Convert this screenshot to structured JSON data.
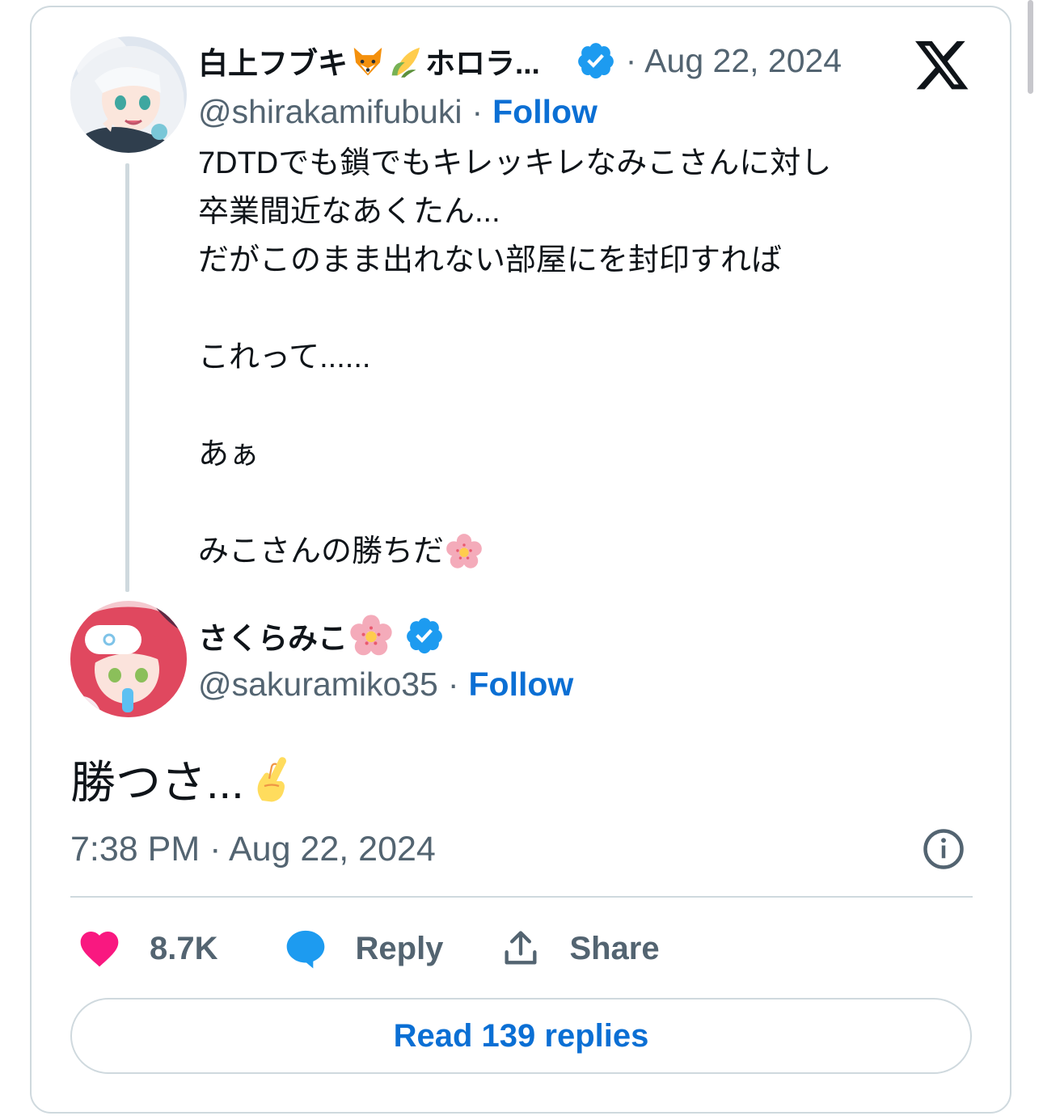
{
  "quoted_tweet": {
    "display_name": "白上フブキ",
    "name_suffix": "ホロラ...",
    "name_emojis": [
      "fox-emoji",
      "corn-emoji"
    ],
    "separator": "·",
    "date": "Aug 22, 2024",
    "handle": "@shirakamifubuki",
    "follow_label": "Follow",
    "text_lines": [
      "7DTDでも鎖でもキレッキレなみこさんに対し",
      "卒業間近なあくたん...",
      "だがこのまま出れない部屋にを封印すれば",
      "",
      "これって......",
      "",
      "あぁ",
      "",
      "みこさんの勝ちだ"
    ],
    "last_line_emoji": "cherry-blossom-emoji"
  },
  "main_tweet": {
    "display_name": "さくらみこ",
    "name_emoji": "cherry-blossom-emoji",
    "handle": "@sakuramiko35",
    "separator": "·",
    "follow_label": "Follow",
    "text": "勝つさ...",
    "text_emoji": "crossed-fingers-emoji",
    "timestamp": "7:38 PM · Aug 22, 2024"
  },
  "actions": {
    "like_count": "8.7K",
    "reply_label": "Reply",
    "share_label": "Share"
  },
  "read_replies_label": "Read 139 replies",
  "colors": {
    "link": "#0b6fd4",
    "verified": "#1d9bf0",
    "heart": "#f91880",
    "reply_bubble": "#1d9bf0",
    "secondary_text": "#536471",
    "border": "#cfd9de"
  }
}
